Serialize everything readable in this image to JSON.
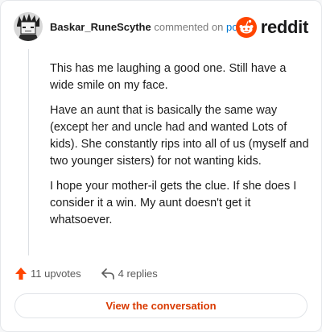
{
  "header": {
    "username": "Baskar_RuneScythe",
    "action_text": "commented on",
    "post_link": "post"
  },
  "brand": {
    "logo_text": "reddit",
    "accent": "#ff4500"
  },
  "comment": {
    "paragraphs": [
      "This has me laughing a good one. Still have a wide smile on my face.",
      "Have an aunt that is basically the same way (except her and uncle had and wanted Lots of kids). She constantly rips into all of us (myself and two younger sisters) for not wanting kids.",
      "I hope your mother-il gets the clue. If she does I consider it a win. My aunt doesn't get it whatsoever."
    ]
  },
  "actions": {
    "upvotes": "11 upvotes",
    "replies": "4 replies"
  },
  "cta": {
    "label": "View the conversation",
    "color": "#d93a00"
  }
}
